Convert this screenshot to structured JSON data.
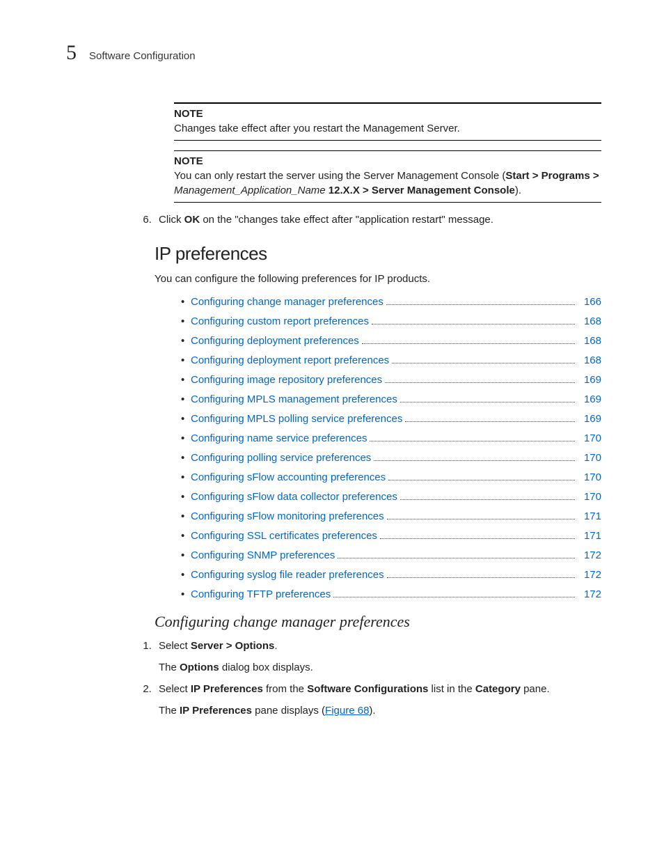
{
  "header": {
    "chapter_number": "5",
    "chapter_title": "Software Configuration"
  },
  "note1": {
    "label": "NOTE",
    "body": "Changes take effect after you restart the Management Server."
  },
  "note2": {
    "label": "NOTE",
    "lead": "You can only restart the server using the Server Management Console (",
    "path1": "Start > Programs > ",
    "appname": "Management_Application_Name",
    "version": " 12.X.X > Server Management Console",
    "tail": ")."
  },
  "step6": {
    "text_a": "Click ",
    "ok": "OK",
    "text_b": " on the \"changes take effect after \"application restart\" message."
  },
  "section_title": "IP preferences",
  "section_intro": "You can configure the following preferences for IP products.",
  "toc": [
    {
      "label": "Configuring change manager preferences",
      "page": "166"
    },
    {
      "label": "Configuring custom report preferences",
      "page": "168"
    },
    {
      "label": "Configuring deployment preferences",
      "page": "168"
    },
    {
      "label": "Configuring deployment report preferences",
      "page": "168"
    },
    {
      "label": "Configuring image repository preferences",
      "page": "169"
    },
    {
      "label": "Configuring MPLS management preferences",
      "page": "169"
    },
    {
      "label": "Configuring MPLS polling service preferences",
      "page": "169"
    },
    {
      "label": "Configuring name service preferences",
      "page": "170"
    },
    {
      "label": "Configuring polling service preferences",
      "page": "170"
    },
    {
      "label": "Configuring sFlow accounting preferences",
      "page": "170"
    },
    {
      "label": "Configuring sFlow data collector preferences",
      "page": "170"
    },
    {
      "label": "Configuring sFlow monitoring preferences",
      "page": "171"
    },
    {
      "label": "Configuring SSL certificates preferences",
      "page": "171"
    },
    {
      "label": "Configuring SNMP preferences",
      "page": "172"
    },
    {
      "label": "Configuring syslog file reader preferences",
      "page": "172"
    },
    {
      "label": "Configuring TFTP preferences",
      "page": "172"
    }
  ],
  "subsection_title": "Configuring change manager preferences",
  "s1": {
    "a": "Select ",
    "b": "Server > Options",
    "c": ".",
    "sub_a": "The ",
    "sub_b": "Options",
    "sub_c": " dialog box displays."
  },
  "s2": {
    "a": "Select ",
    "b": "IP Preferences",
    "c": " from the ",
    "d": "Software Configurations",
    "e": " list in the ",
    "f": "Category",
    "g": " pane.",
    "sub_a": "The ",
    "sub_b": "IP Preferences",
    "sub_c": " pane displays (",
    "fig": "Figure 68",
    "sub_d": ")."
  }
}
